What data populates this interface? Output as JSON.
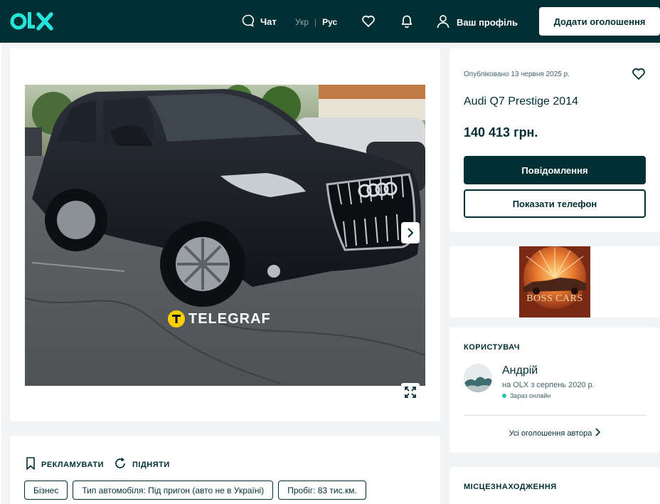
{
  "header": {
    "chat_label": "Чат",
    "lang_uk": "Укр",
    "lang_sep": "|",
    "lang_ru": "Рус",
    "profile_label": "Ваш профіль",
    "add_listing_label": "Додати оголошення"
  },
  "colors": {
    "brand_dark": "#002f34",
    "brand_teal": "#23e5db",
    "logo_yellow": "#ffce32",
    "page_bg": "#f2f4f5"
  },
  "gallery": {
    "watermark_text": "TELEGRAF"
  },
  "actions": {
    "promote_label": "РЕКЛАМУВАТИ",
    "raise_label": "ПІДНЯТИ"
  },
  "tags": [
    "Бізнес",
    "Тип автомобіля: Під пригон (авто не в Україні)",
    "Пробіг: 83 тис.км."
  ],
  "listing": {
    "published": "Опубліковано 13 червня 2025 р.",
    "title": "Audi Q7 Prestige 2014",
    "price": "140 413 грн.",
    "message_button": "Повідомлення",
    "phone_button": "Показати телефон"
  },
  "banner": {
    "text": "BOSS CARS"
  },
  "user": {
    "heading": "КОРИСТУВАЧ",
    "name": "Андрій",
    "since": "на OLX з серпень 2020 р.",
    "online": "Зараз онлайн",
    "all_ads": "Усі оголошення автора"
  },
  "location": {
    "heading": "МІСЦЕЗНАХОДЖЕННЯ"
  }
}
